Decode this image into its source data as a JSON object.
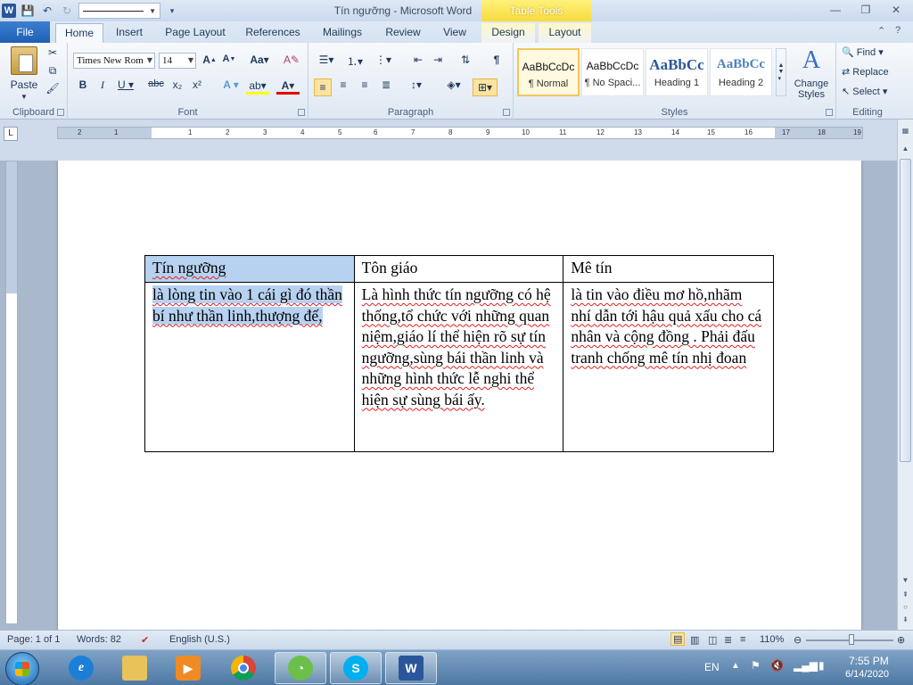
{
  "titlebar": {
    "title": "Tín ngưỡng  -  Microsoft Word",
    "context_tab_group": "Table Tools"
  },
  "tabs": [
    "File",
    "Home",
    "Insert",
    "Page Layout",
    "References",
    "Mailings",
    "Review",
    "View",
    "Design",
    "Layout"
  ],
  "ribbon": {
    "clipboard": {
      "paste": "Paste",
      "label": "Clipboard"
    },
    "font": {
      "family": "Times New Rom",
      "size": "14",
      "label": "Font"
    },
    "paragraph": {
      "label": "Paragraph"
    },
    "styles": {
      "label": "Styles",
      "items": [
        {
          "preview": "AaBbCcDc",
          "name": "¶ Normal"
        },
        {
          "preview": "AaBbCcDc",
          "name": "¶ No Spaci..."
        },
        {
          "preview": "AaBbCc",
          "name": "Heading 1"
        },
        {
          "preview": "AaBbCc",
          "name": "Heading 2"
        }
      ],
      "change_styles": "Change Styles"
    },
    "editing": {
      "find": "Find",
      "replace": "Replace",
      "select": "Select",
      "label": "Editing"
    }
  },
  "ruler": {
    "numbers": [
      "2",
      "1",
      "1",
      "2",
      "3",
      "4",
      "5",
      "6",
      "7",
      "8",
      "9",
      "10",
      "11",
      "12",
      "13",
      "14",
      "15",
      "16",
      "17",
      "18",
      "19"
    ]
  },
  "document": {
    "table": {
      "header": [
        "Tín ngưỡng",
        "Tôn giáo",
        "Mê tín"
      ],
      "row": [
        "là lòng tin vào 1 cái gì đó thần bí như thần linh,thượng đế,",
        "Là hình thức tín ngưỡng có hệ thống,tổ chức với những quan niệm,giáo lí thể hiện rõ sự tín ngưỡng,sùng bái thần linh và những hình thức lễ nghi thể hiện sự sùng bái ấy.",
        "là tin vào điều mơ hồ,nhãm nhí dẫn tới hậu quả xấu cho cá nhân và cộng đồng . Phải đấu tranh chống mê tín nhị đoan"
      ]
    }
  },
  "statusbar": {
    "page": "Page: 1 of 1",
    "words": "Words: 82",
    "language": "English (U.S.)",
    "zoom": "110%"
  },
  "taskbar": {
    "lang": "EN",
    "time": "7:55 PM",
    "date": "6/14/2020"
  },
  "colors": {
    "selection": "#b7d2f0",
    "file_tab": "#1e5fb4",
    "table_tools": "#f7da3d"
  }
}
